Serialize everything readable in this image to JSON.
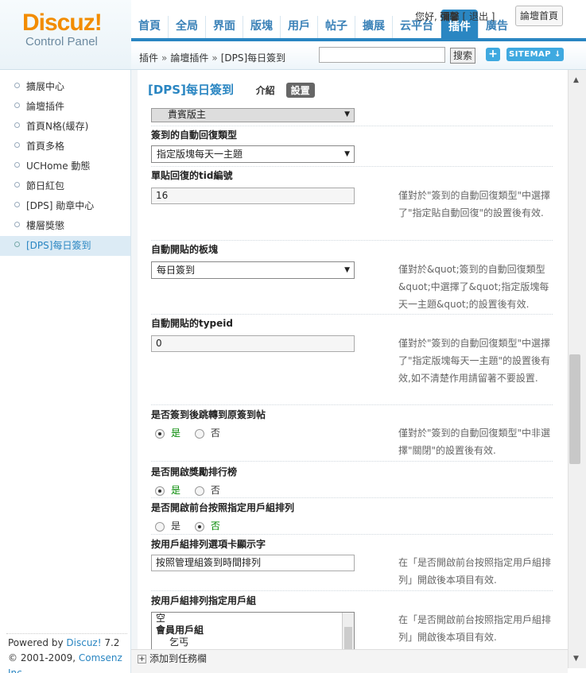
{
  "logo": {
    "brand": "Discuz!",
    "subtitle": "Control Panel"
  },
  "nav": {
    "tabs": [
      "首頁",
      "全局",
      "界面",
      "版塊",
      "用戶",
      "帖子",
      "擴展",
      "云平台",
      "插件",
      "廣告"
    ],
    "active_tab": "插件"
  },
  "user": {
    "greeting": "您好,",
    "name": "彌馨",
    "logout": "[ 退出 ]"
  },
  "home_button": "論壇首頁",
  "breadcrumb": {
    "items": [
      "插件",
      "論壇插件",
      "[DPS]每日簽到"
    ],
    "sep": "»"
  },
  "search": {
    "button": "搜索",
    "value": ""
  },
  "sitemap_button": "SITEMAP",
  "plus_button": "+",
  "sidebar": {
    "items": [
      "擴展中心",
      "論壇插件",
      "首頁N格(緩存)",
      "首頁多格",
      "UCHome 動態",
      "節日紅包",
      "[DPS] 勛章中心",
      "樓層獎懲",
      "[DPS]每日簽到"
    ],
    "active_index": 8
  },
  "footer": {
    "powered": "Powered by",
    "brand": "Discuz!",
    "version": "7.2",
    "copyright": "© 2001-2009,",
    "company": "Comsenz Inc."
  },
  "page": {
    "title": "[DPS]每日簽到",
    "intro_link": "介紹",
    "settings_tab": "設置"
  },
  "form": {
    "partial_select_value": "貴賓版主",
    "f1": {
      "label": "簽到的自動回復類型",
      "value": "指定版塊每天一主題"
    },
    "f2": {
      "label": "單貼回復的tid編號",
      "value": "16",
      "hint": "僅對於\"簽到的自動回復類型\"中選擇了\"指定貼自動回復\"的設置後有效."
    },
    "f3": {
      "label": "自動開貼的板塊",
      "value": "每日簽到",
      "hint": "僅對於&quot;簽到的自動回復類型&quot;中選擇了&quot;指定版塊每天一主題&quot;的設置後有效."
    },
    "f4": {
      "label": "自動開貼的typeid",
      "value": "0",
      "hint": "僅對於\"簽到的自動回復類型\"中選擇了\"指定版塊每天一主題\"的設置後有效,如不清楚作用請留著不要設置."
    },
    "f5": {
      "label": "是否簽到後跳轉到原簽到帖",
      "yes": "是",
      "no": "否",
      "hint": "僅對於\"簽到的自動回復類型\"中非選擇\"關閉\"的設置後有效."
    },
    "f6": {
      "label": "是否開啟獎勵排行榜",
      "yes": "是",
      "no": "否"
    },
    "f7": {
      "label": "是否開啟前台按照指定用戶組排列",
      "yes": "是",
      "no": "否"
    },
    "f8": {
      "label": "按用戶組排列選項卡顯示字",
      "value": "按照管理組簽到時間排列",
      "hint": "在「是否開啟前台按照指定用戶組排列」開啟後本項目有效."
    },
    "f9": {
      "label": "按用戶組排列指定用戶組",
      "options": [
        "空",
        "會員用戶組",
        "乞丐"
      ],
      "hint": "在「是否開啟前台按照指定用戶組排列」開啟後本項目有效."
    }
  },
  "bottom": {
    "add_to_taskbar": "添加到任務欄"
  }
}
